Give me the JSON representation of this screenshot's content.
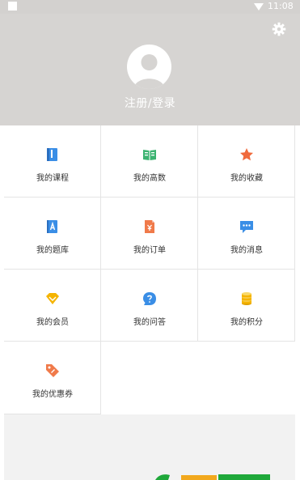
{
  "status_bar": {
    "time": "11:08"
  },
  "header": {
    "login_label": "注册/登录",
    "settings_icon": "gear-icon"
  },
  "menu": [
    {
      "label": "我的课程",
      "icon": "book-icon",
      "color": "#3a8ee6"
    },
    {
      "label": "我的高数",
      "icon": "open-book-icon",
      "color": "#3cb371"
    },
    {
      "label": "我的收藏",
      "icon": "star-icon",
      "color": "#f06a3c"
    },
    {
      "label": "我的题库",
      "icon": "question-bank-icon",
      "color": "#3a8ee6"
    },
    {
      "label": "我的订单",
      "icon": "order-icon",
      "color": "#f07a4a"
    },
    {
      "label": "我的消息",
      "icon": "message-icon",
      "color": "#3a8ee6"
    },
    {
      "label": "我的会员",
      "icon": "vip-diamond-icon",
      "color": "#f5b400"
    },
    {
      "label": "我的问答",
      "icon": "question-icon",
      "color": "#3a8ee6"
    },
    {
      "label": "我的积分",
      "icon": "coins-icon",
      "color": "#f5b400"
    },
    {
      "label": "我的优惠券",
      "icon": "coupon-icon",
      "color": "#f07a4a"
    }
  ]
}
